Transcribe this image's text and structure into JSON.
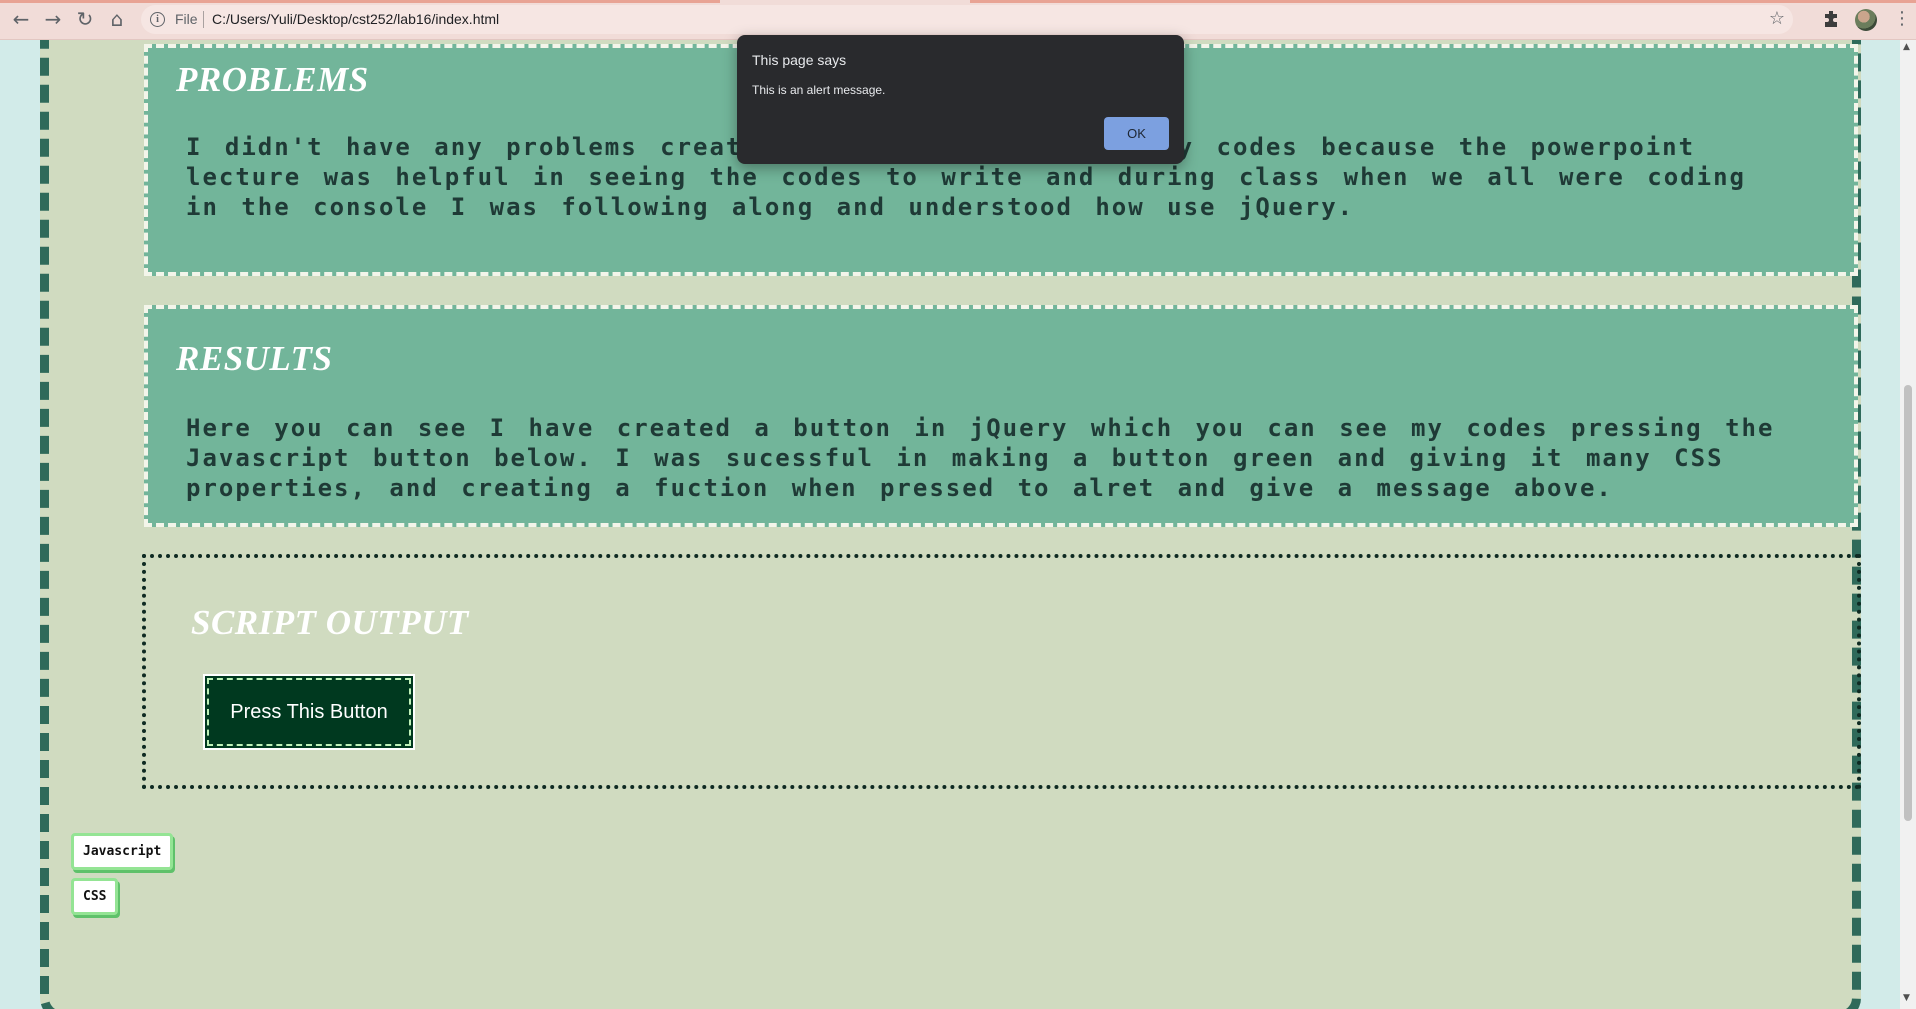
{
  "browser": {
    "nav": {
      "back": "←",
      "forward": "→",
      "reload": "↻",
      "home": "⌂"
    },
    "scheme": "File",
    "url": "C:/Users/Yuli/Desktop/cst252/lab16/index.html",
    "star": "☆",
    "menu": "⋮"
  },
  "problems": {
    "title": "PROBLEMS",
    "body": "I didn't have any problems creating the codes using jQuery codes because the powerpoint lecture was helpful in seeing the codes to write and during class when we all were coding in the console I was following along and understood how use jQuery."
  },
  "results": {
    "title": "RESULTS",
    "body": "Here you can see I have created a button in jQuery which you can see my codes pressing the Javascript button below. I was sucessful in making a button green and giving it many CSS properties, and creating a fuction when pressed to alret and give a message above."
  },
  "script_output": {
    "title": "SCRIPT OUTPUT",
    "button_label": "Press This Button"
  },
  "links": {
    "javascript": "Javascript",
    "css": "CSS"
  },
  "alert": {
    "title": "This page says",
    "message": "This is an alert message.",
    "ok_label": "OK"
  },
  "colors": {
    "page_bg": "#d2ebe9",
    "container_bg": "#d0dbc0",
    "container_border": "#2f6a5a",
    "section_bg": "#72b59a",
    "button_bg": "#00391f",
    "dialog_bg": "#292a2d",
    "ok_button": "#7ca0e0"
  },
  "icons": [
    "arrow-back-icon",
    "arrow-forward-icon",
    "reload-icon",
    "home-icon",
    "info-icon",
    "star-icon",
    "extensions-icon",
    "profile-avatar",
    "menu-icon"
  ]
}
